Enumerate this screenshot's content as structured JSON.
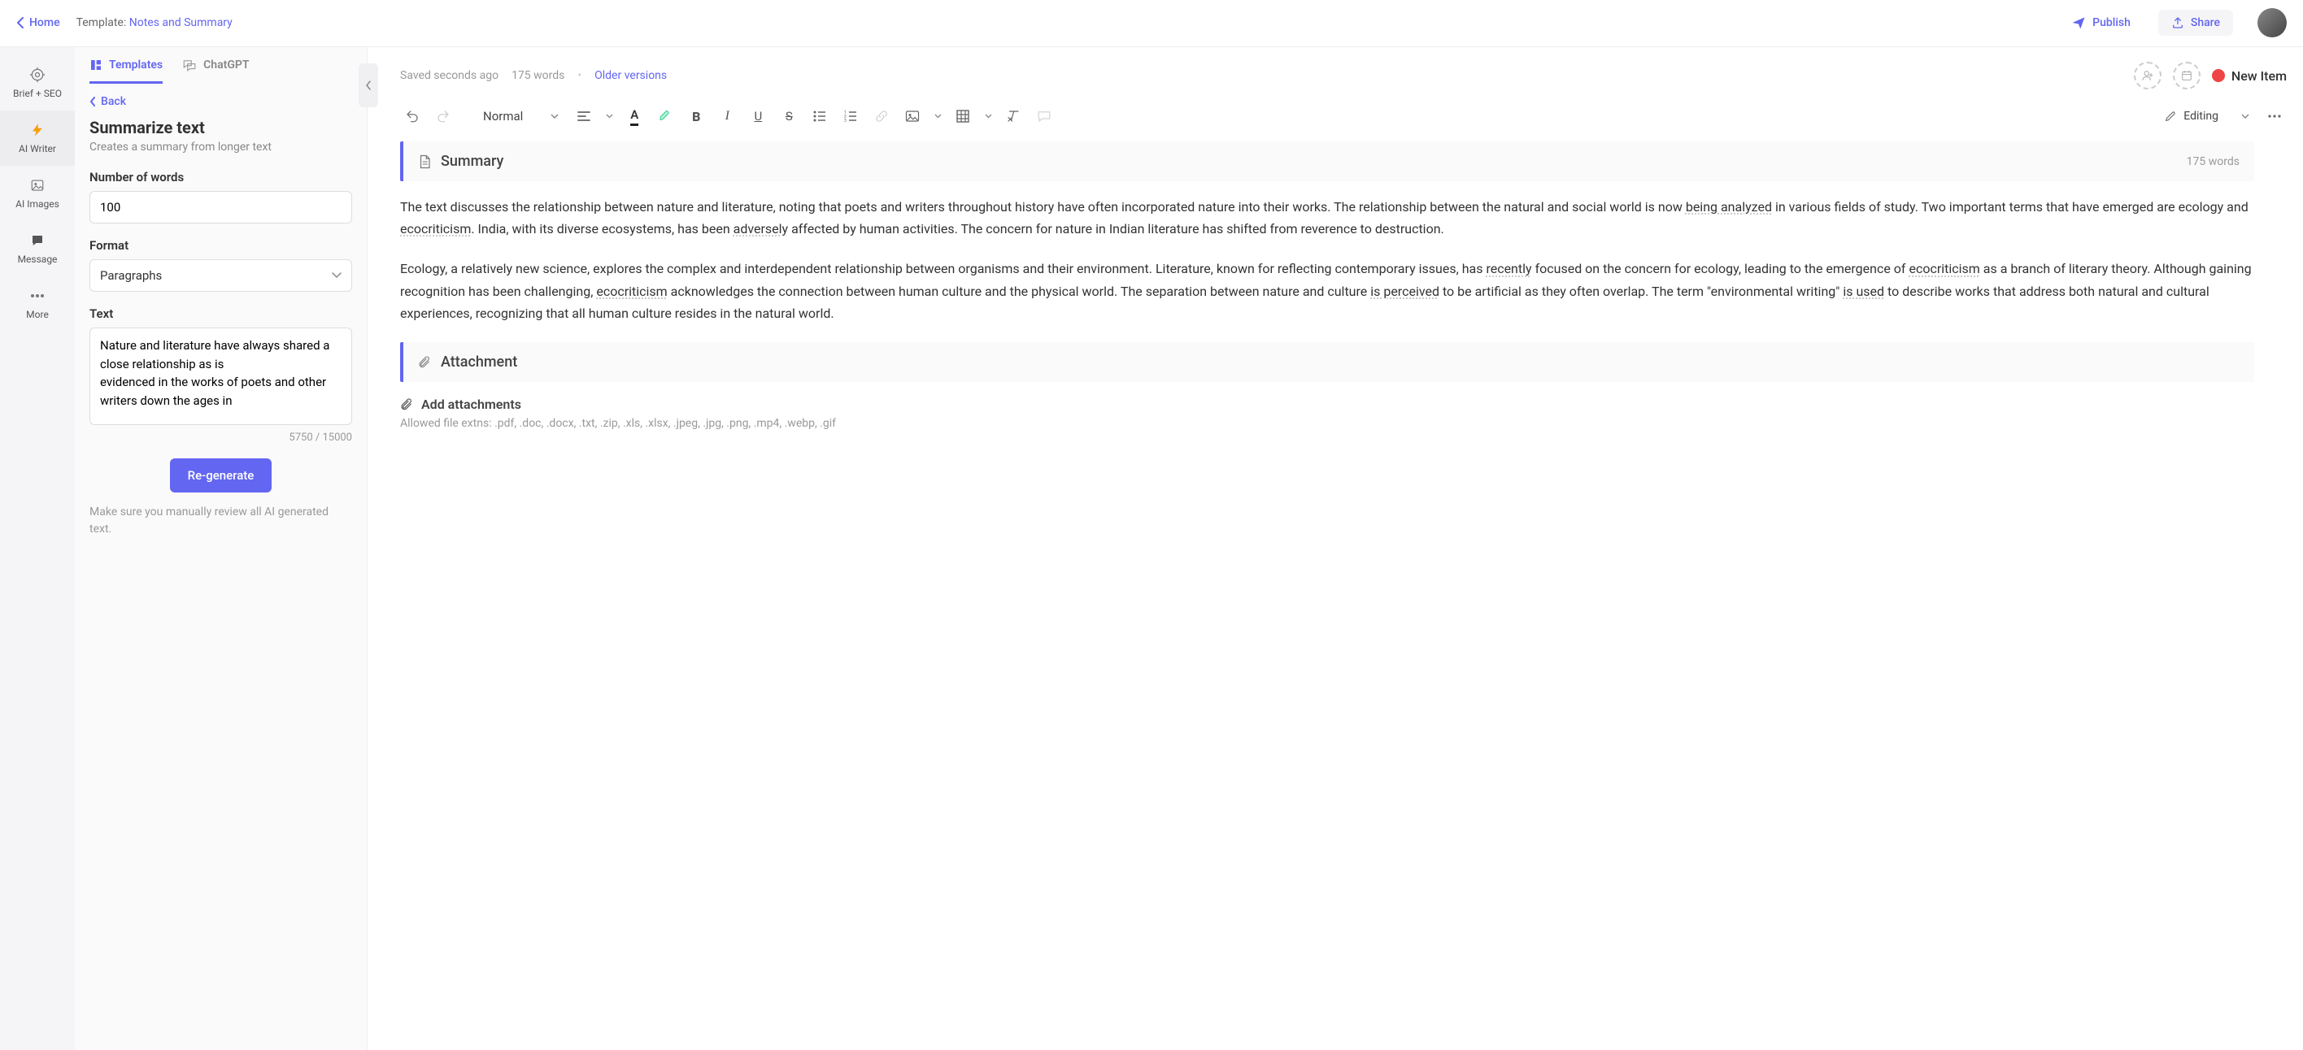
{
  "header": {
    "home": "Home",
    "template_prefix": "Template: ",
    "template_name": "Notes and Summary",
    "publish": "Publish",
    "share": "Share"
  },
  "rail": {
    "brief_seo": "Brief + SEO",
    "ai_writer": "AI Writer",
    "ai_images": "AI Images",
    "message": "Message",
    "more": "More"
  },
  "panel": {
    "tab_templates": "Templates",
    "tab_chatgpt": "ChatGPT",
    "back": "Back",
    "title": "Summarize text",
    "subtitle": "Creates a summary from longer text",
    "num_words_label": "Number of words",
    "num_words_value": "100",
    "format_label": "Format",
    "format_value": "Paragraphs",
    "text_label": "Text",
    "text_value": "Nature and literature have always shared a close relationship as is\nevidenced in the works of poets and other writers down the ages in",
    "char_count": "5750 / 15000",
    "regenerate": "Re-generate",
    "review_note": "Make sure you manually review all AI generated text."
  },
  "editor": {
    "save_status": "Saved seconds ago",
    "word_count": "175 words",
    "older_versions": "Older versions",
    "new_item": "New Item",
    "style_select": "Normal",
    "editing_label": "Editing"
  },
  "doc": {
    "summary_title": "Summary",
    "summary_meta": "175 words",
    "p1_a": "The text discusses the relationship between nature and literature, noting that poets and writers throughout history have often incorporated nature into their works. The relationship between the natural and social world is now ",
    "p1_w1": "being analyzed",
    "p1_b": " in various fields of study. Two important terms that have emerged are ecology and ",
    "p1_w2": "ecocriticism",
    "p1_c": ". India, with its diverse ecosystems, has been ",
    "p1_w3": "adversely",
    "p1_d": " affected by human activities. The concern for nature in Indian literature has shifted from reverence to destruction.",
    "p2_a": "Ecology, a relatively new science, explores the complex and interdependent relationship between organisms and their environment. Literature, known for reflecting contemporary issues, has ",
    "p2_w1": "recently",
    "p2_b": " focused on the concern for ecology, leading to the emergence of ",
    "p2_w2": "ecocriticism",
    "p2_c": " as a branch of literary theory. Although gaining recognition has been challenging, ",
    "p2_w3": "ecocriticism",
    "p2_d": " acknowledges the connection between human culture and the physical world. The separation between nature and culture ",
    "p2_w4": "is perceived",
    "p2_e": " to be artificial as they often overlap. The term \"environmental writing\" ",
    "p2_w5": "is used",
    "p2_f": " to describe works that address both natural and cultural experiences, recognizing that all human culture resides in the natural world.",
    "attach_title": "Attachment",
    "add_attach": "Add attachments",
    "attach_hint": "Allowed file extns: .pdf, .doc, .docx, .txt, .zip, .xls, .xlsx, .jpeg, .jpg, .png, .mp4, .webp, .gif"
  }
}
